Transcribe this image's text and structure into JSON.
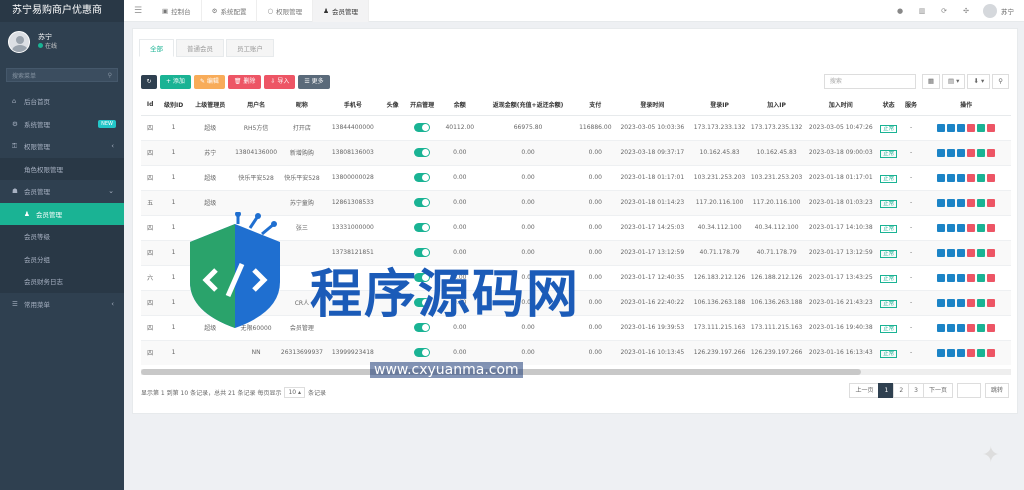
{
  "app": {
    "title": "苏宁易购商户优惠商"
  },
  "user": {
    "name": "苏宁",
    "status": "在线"
  },
  "sidebar": {
    "search_placeholder": "搜索菜单",
    "items": [
      {
        "label": "后台首页",
        "icon": "home-icon",
        "type": "top"
      },
      {
        "label": "系统管理",
        "icon": "gear-icon",
        "type": "top",
        "badge": "NEW"
      },
      {
        "label": "权限管理",
        "icon": "key-icon",
        "type": "top",
        "chevron": "‹"
      },
      {
        "label": "角色权限管理",
        "icon": "",
        "type": "sub"
      },
      {
        "label": "会员管理",
        "icon": "users-icon",
        "type": "top",
        "chevron": "⌄"
      },
      {
        "label": "会员管理",
        "icon": "user-icon",
        "type": "sub",
        "active": true
      },
      {
        "label": "会员等级",
        "icon": "",
        "type": "sub"
      },
      {
        "label": "会员分组",
        "icon": "",
        "type": "sub"
      },
      {
        "label": "会员财务日志",
        "icon": "",
        "type": "sub"
      },
      {
        "label": "常用菜单",
        "icon": "list-icon",
        "type": "top",
        "chevron": "‹"
      }
    ]
  },
  "topbar": {
    "tabs": [
      {
        "label": "控制台",
        "icon": "dashboard-icon"
      },
      {
        "label": "系统配置",
        "icon": "gear-icon"
      },
      {
        "label": "权限管理",
        "icon": "circle-icon"
      },
      {
        "label": "会员管理",
        "icon": "user-icon",
        "active": true
      }
    ],
    "user_name": "苏宁"
  },
  "subtabs": [
    "全部",
    "普通会员",
    "员工账户"
  ],
  "toolbar": {
    "buttons": [
      {
        "label": "↻",
        "style": "dark"
      },
      {
        "label": "+ 添加",
        "style": "green"
      },
      {
        "label": "✎ 编辑",
        "style": "orange"
      },
      {
        "label": "🗑 删除",
        "style": "red"
      },
      {
        "label": "⇩ 导入",
        "style": "red"
      },
      {
        "label": "☰ 更多",
        "style": "gray"
      }
    ],
    "search_placeholder": "搜索"
  },
  "table": {
    "headers": [
      "Id",
      "级别ID",
      "上级管理员",
      "用户名",
      "昵称",
      "手机号",
      "头像",
      "开启管理",
      "余额",
      "返现金额(充值+返还余额)",
      "支付",
      "登录时间",
      "登录IP",
      "加入IP",
      "加入时间",
      "状态",
      "服务",
      "操作"
    ],
    "rows": [
      [
        "四",
        "1",
        "超级",
        "RH5方信",
        "打开店",
        "13844400000",
        "",
        "on",
        "40112.00",
        "",
        "66975.80",
        "116886.00",
        "2023-03-05 10:03:36",
        "173.173.233.132",
        "173.173.235.132",
        "2023-03-05 10:47:26",
        "正常",
        "-"
      ],
      [
        "四",
        "1",
        "苏宁",
        "13804136000",
        "新增购购",
        "13808136003",
        "",
        "on",
        "0.00",
        "",
        "0.00",
        "0.00",
        "2023-03-18 09:37:17",
        "10.162.45.83",
        "10.162.45.83",
        "2023-03-18 09:00:03",
        "正常",
        "-"
      ],
      [
        "四",
        "1",
        "超级",
        "快乐平安528",
        "快乐平安528",
        "13800000028",
        "",
        "on",
        "0.00",
        "",
        "0.00",
        "0.00",
        "2023-01-18 01:17:01",
        "103.231.253.203",
        "103.231.253.203",
        "2023-01-18 01:17:01",
        "正常",
        "-"
      ],
      [
        "五",
        "1",
        "超级",
        "",
        "苏宁童购",
        "12861308533",
        "",
        "on",
        "0.00",
        "",
        "0.00",
        "0.00",
        "2023-01-18 01:14:23",
        "117.20.116.100",
        "117.20.116.100",
        "2023-01-18 01:03:23",
        "正常",
        "-"
      ],
      [
        "四",
        "1",
        "",
        "",
        "张三",
        "13331000000",
        "",
        "on",
        "0.00",
        "",
        "0.00",
        "0.00",
        "2023-01-17 14:25:03",
        "40.34.112.100",
        "40.34.112.100",
        "2023-01-17 14:10:38",
        "正常",
        "-"
      ],
      [
        "四",
        "1",
        "",
        "",
        "",
        "13738121851",
        "",
        "on",
        "0.00",
        "",
        "0.00",
        "0.00",
        "2023-01-17 13:12:59",
        "40.71.178.79",
        "40.71.178.79",
        "2023-01-17 13:12:59",
        "正常",
        "-"
      ],
      [
        "六",
        "1",
        "",
        "",
        "",
        "",
        "",
        "on",
        "0.00",
        "",
        "0.00",
        "0.00",
        "2023-01-17 12:40:35",
        "126.183.212.126",
        "126.188.212.126",
        "2023-01-17 13:43:25",
        "正常",
        "-"
      ],
      [
        "四",
        "1",
        "",
        "",
        "CR人",
        "",
        "",
        "on",
        "0.00",
        "",
        "0.00",
        "0.00",
        "2023-01-16 22:40:22",
        "106.136.263.188",
        "106.136.263.188",
        "2023-01-16 21:43:23",
        "正常",
        "-"
      ],
      [
        "四",
        "1",
        "超级",
        "无限60000",
        "会员管理",
        "",
        "",
        "on",
        "0.00",
        "",
        "0.00",
        "0.00",
        "2023-01-16 19:39:53",
        "173.111.215.163",
        "173.111.215.163",
        "2023-01-16 19:40:38",
        "正常",
        "-"
      ],
      [
        "四",
        "1",
        "",
        "NN",
        "26313699937",
        "13999923418",
        "",
        "on",
        "0.00",
        "",
        "0.00",
        "0.00",
        "2023-01-16 10:13:45",
        "126.239.197.266",
        "126.239.197.266",
        "2023-01-16 16:13:43",
        "正常",
        "-"
      ]
    ]
  },
  "pagination": {
    "info_prefix": "显示第 1 到第 10 条记录，总共 21 条记录 每页显示",
    "page_size": "10",
    "info_suffix": "条记录",
    "prev": "上一页",
    "pages": [
      "1",
      "2",
      "3"
    ],
    "next": "下一页",
    "go": "跳转"
  },
  "watermark": {
    "text": "程序源码网",
    "url": "www.cxyuanma.com"
  }
}
